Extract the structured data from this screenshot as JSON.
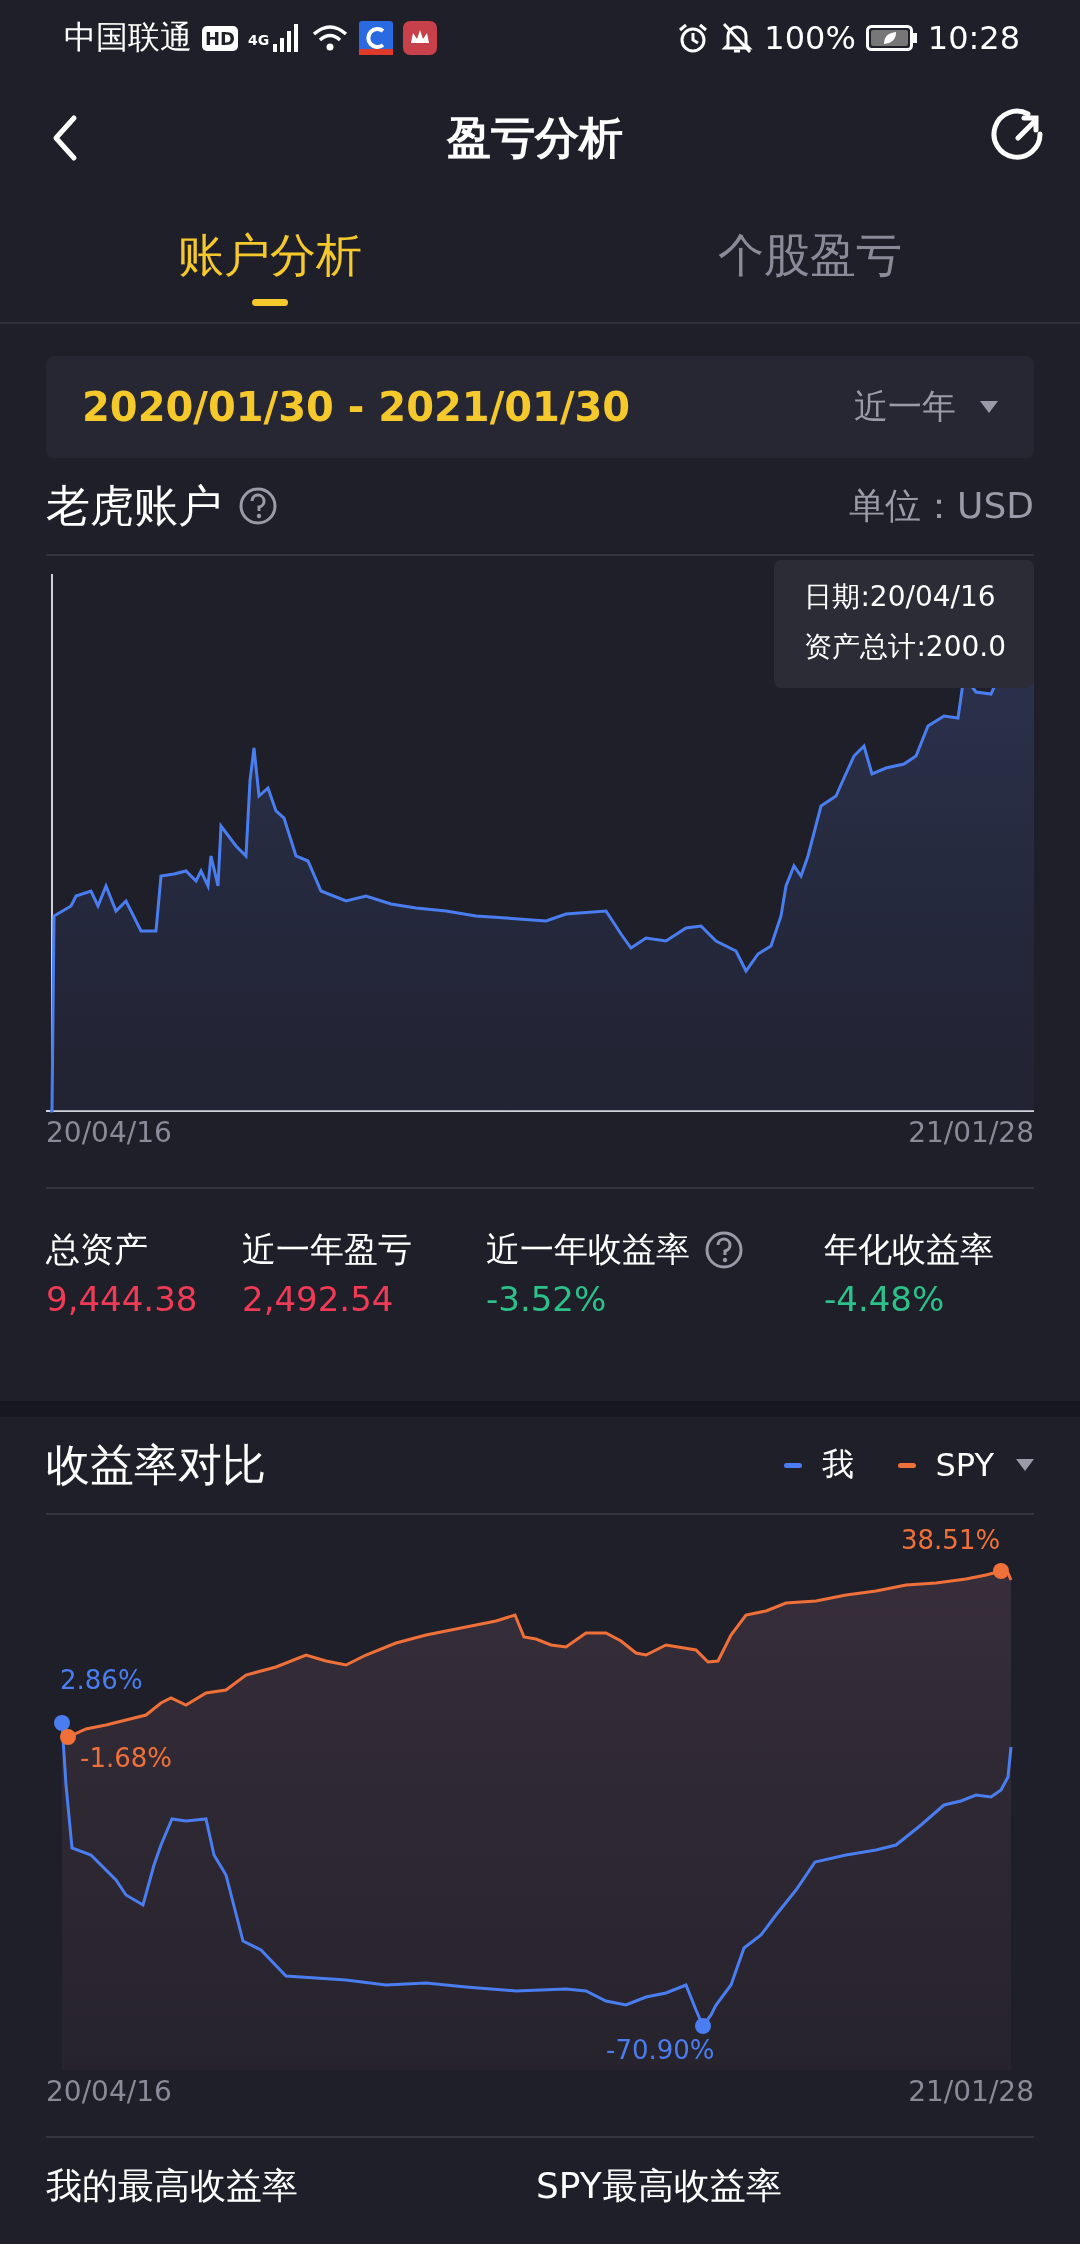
{
  "status_bar": {
    "carrier": "中国联通",
    "hd": "HD",
    "network": "4G",
    "battery": "100%",
    "time": "10:28"
  },
  "header": {
    "title": "盈亏分析"
  },
  "tabs": [
    {
      "label": "账户分析",
      "selected": true
    },
    {
      "label": "个股盈亏",
      "selected": false
    }
  ],
  "date_range": {
    "value": "2020/01/30 - 2021/01/30",
    "period": "近一年"
  },
  "account": {
    "title": "老虎账户",
    "unit": "单位：USD",
    "tooltip": {
      "date": "日期:20/04/16",
      "total": "资产总计:200.0"
    },
    "x_start": "20/04/16",
    "x_end": "21/01/28"
  },
  "stats": [
    {
      "label": "总资产",
      "value": "9,444.38",
      "color": "#ef3b55",
      "help": false
    },
    {
      "label": "近一年盈亏",
      "value": "2,492.54",
      "color": "#ef3b55",
      "help": false
    },
    {
      "label": "近一年收益率",
      "value": "-3.52%",
      "color": "#2dc18a",
      "help": true
    },
    {
      "label": "年化收益率",
      "value": "-4.48%",
      "color": "#2dc18a",
      "help": false
    }
  ],
  "comparison": {
    "title": "收益率对比",
    "legend": [
      {
        "name": "我",
        "color": "#4a7ef0"
      },
      {
        "name": "SPY",
        "color": "#f0703a"
      }
    ],
    "point_labels": [
      {
        "text": "2.86%",
        "color": "#4a7ef0"
      },
      {
        "text": "-1.68%",
        "color": "#f0703a"
      },
      {
        "text": "38.51%",
        "color": "#f0703a"
      },
      {
        "text": "-70.90%",
        "color": "#4a7ef0"
      }
    ],
    "x_start": "20/04/16",
    "x_end": "21/01/28"
  },
  "bottom": [
    "我的最高收益率",
    "SPY最高收益率"
  ]
}
